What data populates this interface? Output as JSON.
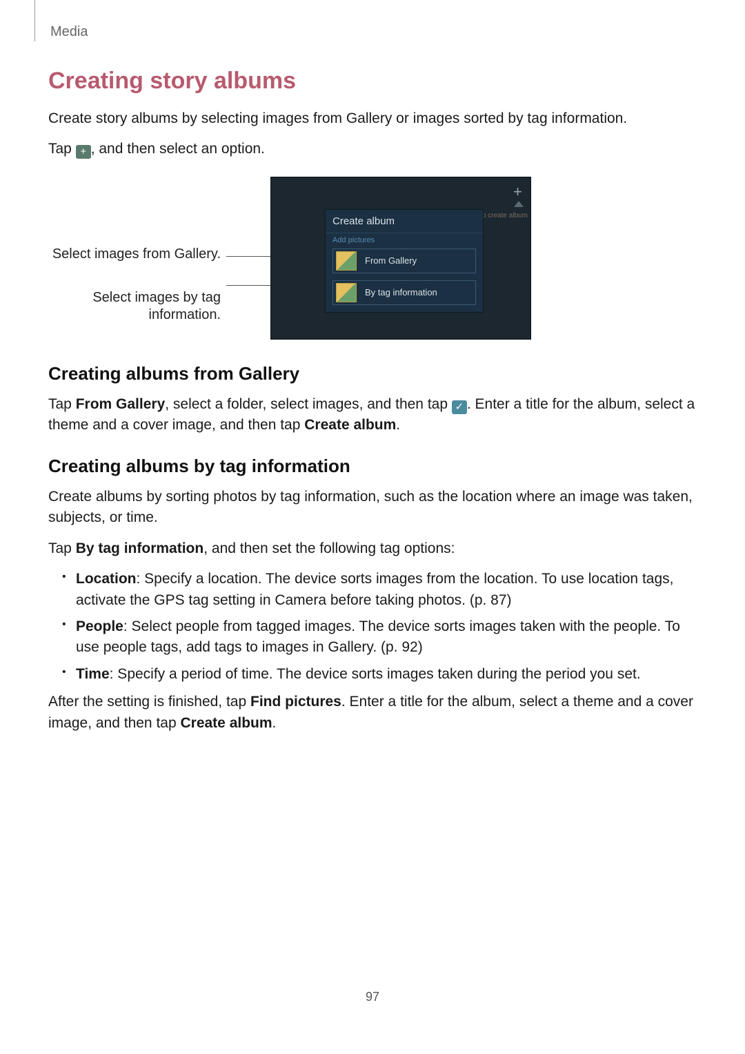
{
  "header": {
    "section": "Media"
  },
  "h1": "Creating story albums",
  "intro": "Create story albums by selecting images from Gallery or images sorted by tag information.",
  "tap_line": {
    "pre": "Tap ",
    "post": ", and then select an option."
  },
  "figure": {
    "callout1": "Select images from Gallery.",
    "callout2": "Select images by tag information.",
    "hint": "o create album",
    "dialog_title": "Create album",
    "dialog_sub": "Add pictures",
    "opt1": "From Gallery",
    "opt2": "By tag information"
  },
  "gallery": {
    "h": "Creating albums from Gallery",
    "p_pre": "Tap ",
    "p_bold1": "From Gallery",
    "p_mid": ", select a folder, select images, and then tap ",
    "p_post": ". Enter a title for the album, select a theme and a cover image, and then tap ",
    "p_bold2": "Create album",
    "p_end": "."
  },
  "tag": {
    "h": "Creating albums by tag information",
    "p1": "Create albums by sorting photos by tag information, such as the location where an image was taken, subjects, or time.",
    "p2_pre": "Tap ",
    "p2_bold": "By tag information",
    "p2_post": ", and then set the following tag options:",
    "items": [
      {
        "b": "Location",
        "t": ": Specify a location. The device sorts images from the location. To use location tags, activate the GPS tag setting in Camera before taking photos. (p. 87)"
      },
      {
        "b": "People",
        "t": ": Select people from tagged images. The device sorts images taken with the people. To use people tags, add tags to images in Gallery. (p. 92)"
      },
      {
        "b": "Time",
        "t": ": Specify a period of time. The device sorts images taken during the period you set."
      }
    ],
    "after_pre": "After the setting is finished, tap ",
    "after_b1": "Find pictures",
    "after_mid": ". Enter a title for the album, select a theme and a cover image, and then tap ",
    "after_b2": "Create album",
    "after_end": "."
  },
  "page": "97"
}
